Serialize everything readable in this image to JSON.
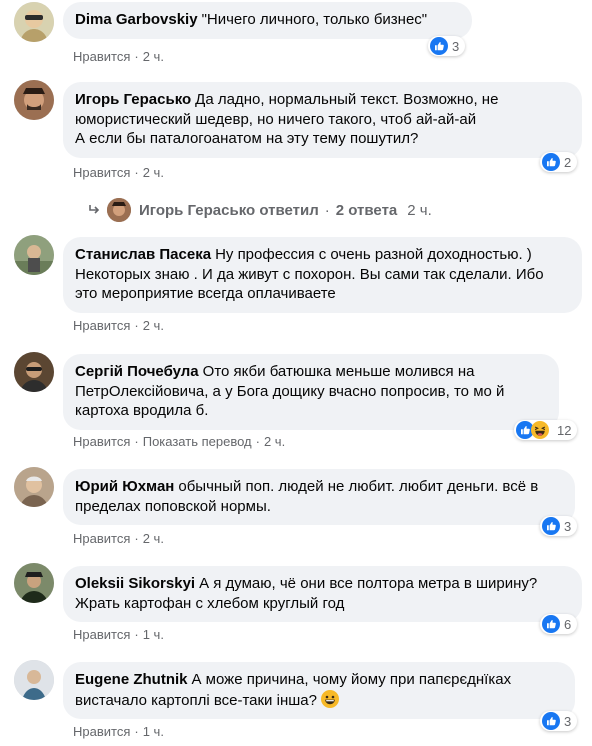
{
  "comments": [
    {
      "author": "Dima Garbovskiy",
      "text": "\"Ничего личного, только бизнес\"",
      "like": "Нравится",
      "time": "2 ч.",
      "reaction_count": "3"
    },
    {
      "author": "Игорь Герасько",
      "text": "Да ладно, нормальный текст. Возможно, не юмористический шедевр, но ничего такого, чтоб ай-ай-ай\nА если бы паталогоанатом на эту тему пошутил?",
      "like": "Нравится",
      "time": "2 ч.",
      "reaction_count": "2"
    },
    {
      "author": "Станислав Пасека",
      "text": "Ну профессия с очень разной доходностью. ) Некоторых знаю . И да живут с похорон. Вы сами так сделали. Ибо это мероприятие всегда оплачиваете",
      "like": "Нравится",
      "time": "2 ч."
    },
    {
      "author": "Сергій Почебула",
      "text": "Ото якби батюшка меньше молився на ПетрОлексійовича, а у Бога дощику вчасно попросив, то мо й картоха вродила б.",
      "like": "Нравится",
      "translate": "Показать перевод",
      "time": "2 ч.",
      "reaction_count": "12"
    },
    {
      "author": "Юрий Юхман",
      "text": "обычный поп. людей не любит. любит деньги. всё в пределах поповской нормы.",
      "like": "Нравится",
      "time": "2 ч.",
      "reaction_count": "3"
    },
    {
      "author": "Oleksii Sikorskyi",
      "text": "А я думаю, чё они все полтора метра в ширину? Жрать картофан с хлебом круглый год",
      "like": "Нравится",
      "time": "1 ч.",
      "reaction_count": "6"
    },
    {
      "author": "Eugene Zhutnik",
      "text": "А може причина, чому йому при папєрєднїках вистачало картоплі все-таки інша?",
      "like": "Нравится",
      "time": "1 ч.",
      "reaction_count": "3"
    }
  ],
  "replies_row": {
    "label": "Игорь Герасько ответил",
    "count": "2 ответа",
    "time": "2 ч."
  },
  "colors": {
    "bubble": "#f0f2f5",
    "meta_text": "#65676b",
    "like_blue": "#1877f2",
    "haha_yellow": "#f7b928"
  },
  "icons": [
    "like-reaction-icon",
    "haha-reaction-icon",
    "reply-arrow-icon",
    "grinning-emoji-icon"
  ]
}
